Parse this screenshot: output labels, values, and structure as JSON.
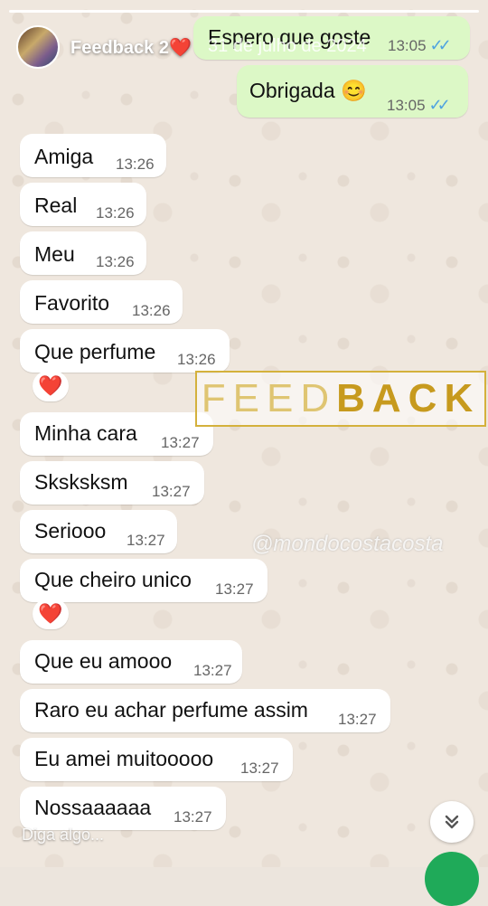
{
  "story": {
    "title": "Feedback 2",
    "heart": "❤️",
    "date_overlay": "31 de julho de 2024",
    "reply_placeholder": "Diga algo..."
  },
  "outgoing": [
    {
      "text": "Espero que goste",
      "time": "13:05",
      "status": "read"
    },
    {
      "text": "Obrigada 😊",
      "time": "13:05",
      "status": "read"
    }
  ],
  "incoming": [
    {
      "text": "Amiga",
      "time": "13:26"
    },
    {
      "text": "Real",
      "time": "13:26"
    },
    {
      "text": "Meu",
      "time": "13:26"
    },
    {
      "text": "Favorito",
      "time": "13:26"
    },
    {
      "text": "Que perfume",
      "time": "13:26",
      "reaction": "❤️"
    },
    {
      "text": "Minha cara",
      "time": "13:27"
    },
    {
      "text": "Sksksksm",
      "time": "13:27"
    },
    {
      "text": "Seriooo",
      "time": "13:27"
    },
    {
      "text": "Que cheiro unico",
      "time": "13:27",
      "reaction": "❤️"
    },
    {
      "text": "Que eu amooo",
      "time": "13:27"
    },
    {
      "text": "Raro eu achar perfume assim",
      "time": "13:27"
    },
    {
      "text": "Eu amei muitooooo",
      "time": "13:27"
    },
    {
      "text": "Nossaaaaaa",
      "time": "13:27"
    }
  ],
  "sticker": {
    "light": "FEED",
    "bold": "BACK"
  },
  "watermark": "@mondocostacosta",
  "icons": {
    "scroll": "double-chevron-down-icon",
    "ticks": "double-check-icon"
  },
  "colors": {
    "outgoing_bubble": "#dcf8c6",
    "incoming_bubble": "#ffffff",
    "read_ticks": "#4fa3e0",
    "accent": "#c79a1e"
  }
}
